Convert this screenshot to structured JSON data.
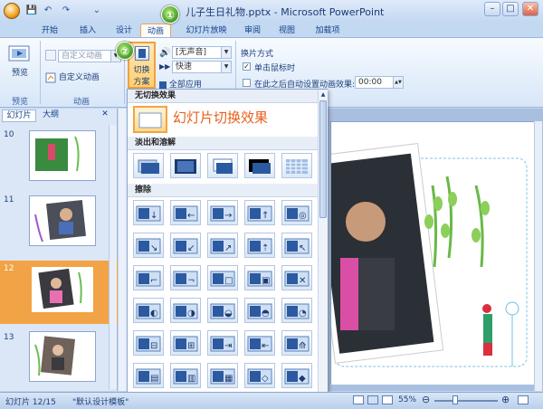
{
  "window": {
    "title": "儿子生日礼物.pptx - Microsoft PowerPoint",
    "minimize": "–",
    "maximize": "□",
    "close": "✕"
  },
  "quick_access": {
    "save": "💾",
    "undo": "↶",
    "redo": "↷",
    "more": "⌄"
  },
  "tabs": [
    {
      "label": "开始"
    },
    {
      "label": "插入"
    },
    {
      "label": "设计"
    },
    {
      "label": "动画",
      "active": true
    },
    {
      "label": "幻灯片放映"
    },
    {
      "label": "审阅"
    },
    {
      "label": "视图"
    },
    {
      "label": "加载项"
    }
  ],
  "ribbon": {
    "preview_group": {
      "button": "预览",
      "label": "预览"
    },
    "animation_group": {
      "animate_combo": "自定义动画",
      "custom_animation": "自定义动画",
      "label": "动画"
    },
    "transition_group": {
      "scheme_button_line1": "切换",
      "scheme_button_line2": "方案",
      "sound_value": "[无声音]",
      "speed_value": "快速",
      "apply_all": "全部应用"
    },
    "advance_group": {
      "title": "换片方式",
      "on_click": "单击鼠标时",
      "on_click_checked": true,
      "auto_after": "在此之后自动设置动画效果:",
      "auto_after_checked": false,
      "time_value": "00:00"
    }
  },
  "left_panel": {
    "tabs": [
      "幻灯片",
      "大纲"
    ],
    "close": "✕",
    "slides": [
      {
        "number": "10",
        "selected": false
      },
      {
        "number": "11",
        "selected": false
      },
      {
        "number": "12",
        "selected": true
      },
      {
        "number": "13",
        "selected": false
      }
    ]
  },
  "gallery": {
    "sections": [
      "无切换效果",
      "淡出和溶解",
      "擦除"
    ],
    "annotation": "幻灯片切换效果"
  },
  "steps": [
    "①",
    "②",
    "③"
  ],
  "status_bar": {
    "slide_info": "幻灯片 12/15",
    "theme": "\"默认设计模板\"",
    "zoom": "55%",
    "zoom_out": "⊖",
    "zoom_in": "⊕"
  },
  "colors": {
    "accent": "#f3a346",
    "ribbon_blue": "#15428b",
    "annotation": "#e8601a"
  }
}
